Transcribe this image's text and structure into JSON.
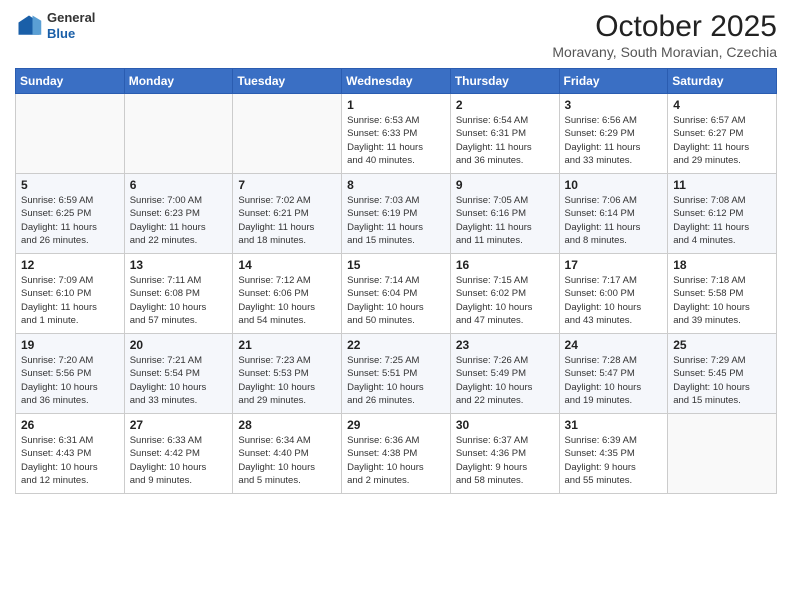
{
  "header": {
    "logo": {
      "general": "General",
      "blue": "Blue"
    },
    "month_year": "October 2025",
    "location": "Moravany, South Moravian, Czechia"
  },
  "days_of_week": [
    "Sunday",
    "Monday",
    "Tuesday",
    "Wednesday",
    "Thursday",
    "Friday",
    "Saturday"
  ],
  "weeks": [
    [
      {
        "day": "",
        "detail": ""
      },
      {
        "day": "",
        "detail": ""
      },
      {
        "day": "",
        "detail": ""
      },
      {
        "day": "1",
        "detail": "Sunrise: 6:53 AM\nSunset: 6:33 PM\nDaylight: 11 hours\nand 40 minutes."
      },
      {
        "day": "2",
        "detail": "Sunrise: 6:54 AM\nSunset: 6:31 PM\nDaylight: 11 hours\nand 36 minutes."
      },
      {
        "day": "3",
        "detail": "Sunrise: 6:56 AM\nSunset: 6:29 PM\nDaylight: 11 hours\nand 33 minutes."
      },
      {
        "day": "4",
        "detail": "Sunrise: 6:57 AM\nSunset: 6:27 PM\nDaylight: 11 hours\nand 29 minutes."
      }
    ],
    [
      {
        "day": "5",
        "detail": "Sunrise: 6:59 AM\nSunset: 6:25 PM\nDaylight: 11 hours\nand 26 minutes."
      },
      {
        "day": "6",
        "detail": "Sunrise: 7:00 AM\nSunset: 6:23 PM\nDaylight: 11 hours\nand 22 minutes."
      },
      {
        "day": "7",
        "detail": "Sunrise: 7:02 AM\nSunset: 6:21 PM\nDaylight: 11 hours\nand 18 minutes."
      },
      {
        "day": "8",
        "detail": "Sunrise: 7:03 AM\nSunset: 6:19 PM\nDaylight: 11 hours\nand 15 minutes."
      },
      {
        "day": "9",
        "detail": "Sunrise: 7:05 AM\nSunset: 6:16 PM\nDaylight: 11 hours\nand 11 minutes."
      },
      {
        "day": "10",
        "detail": "Sunrise: 7:06 AM\nSunset: 6:14 PM\nDaylight: 11 hours\nand 8 minutes."
      },
      {
        "day": "11",
        "detail": "Sunrise: 7:08 AM\nSunset: 6:12 PM\nDaylight: 11 hours\nand 4 minutes."
      }
    ],
    [
      {
        "day": "12",
        "detail": "Sunrise: 7:09 AM\nSunset: 6:10 PM\nDaylight: 11 hours\nand 1 minute."
      },
      {
        "day": "13",
        "detail": "Sunrise: 7:11 AM\nSunset: 6:08 PM\nDaylight: 10 hours\nand 57 minutes."
      },
      {
        "day": "14",
        "detail": "Sunrise: 7:12 AM\nSunset: 6:06 PM\nDaylight: 10 hours\nand 54 minutes."
      },
      {
        "day": "15",
        "detail": "Sunrise: 7:14 AM\nSunset: 6:04 PM\nDaylight: 10 hours\nand 50 minutes."
      },
      {
        "day": "16",
        "detail": "Sunrise: 7:15 AM\nSunset: 6:02 PM\nDaylight: 10 hours\nand 47 minutes."
      },
      {
        "day": "17",
        "detail": "Sunrise: 7:17 AM\nSunset: 6:00 PM\nDaylight: 10 hours\nand 43 minutes."
      },
      {
        "day": "18",
        "detail": "Sunrise: 7:18 AM\nSunset: 5:58 PM\nDaylight: 10 hours\nand 39 minutes."
      }
    ],
    [
      {
        "day": "19",
        "detail": "Sunrise: 7:20 AM\nSunset: 5:56 PM\nDaylight: 10 hours\nand 36 minutes."
      },
      {
        "day": "20",
        "detail": "Sunrise: 7:21 AM\nSunset: 5:54 PM\nDaylight: 10 hours\nand 33 minutes."
      },
      {
        "day": "21",
        "detail": "Sunrise: 7:23 AM\nSunset: 5:53 PM\nDaylight: 10 hours\nand 29 minutes."
      },
      {
        "day": "22",
        "detail": "Sunrise: 7:25 AM\nSunset: 5:51 PM\nDaylight: 10 hours\nand 26 minutes."
      },
      {
        "day": "23",
        "detail": "Sunrise: 7:26 AM\nSunset: 5:49 PM\nDaylight: 10 hours\nand 22 minutes."
      },
      {
        "day": "24",
        "detail": "Sunrise: 7:28 AM\nSunset: 5:47 PM\nDaylight: 10 hours\nand 19 minutes."
      },
      {
        "day": "25",
        "detail": "Sunrise: 7:29 AM\nSunset: 5:45 PM\nDaylight: 10 hours\nand 15 minutes."
      }
    ],
    [
      {
        "day": "26",
        "detail": "Sunrise: 6:31 AM\nSunset: 4:43 PM\nDaylight: 10 hours\nand 12 minutes."
      },
      {
        "day": "27",
        "detail": "Sunrise: 6:33 AM\nSunset: 4:42 PM\nDaylight: 10 hours\nand 9 minutes."
      },
      {
        "day": "28",
        "detail": "Sunrise: 6:34 AM\nSunset: 4:40 PM\nDaylight: 10 hours\nand 5 minutes."
      },
      {
        "day": "29",
        "detail": "Sunrise: 6:36 AM\nSunset: 4:38 PM\nDaylight: 10 hours\nand 2 minutes."
      },
      {
        "day": "30",
        "detail": "Sunrise: 6:37 AM\nSunset: 4:36 PM\nDaylight: 9 hours\nand 58 minutes."
      },
      {
        "day": "31",
        "detail": "Sunrise: 6:39 AM\nSunset: 4:35 PM\nDaylight: 9 hours\nand 55 minutes."
      },
      {
        "day": "",
        "detail": ""
      }
    ]
  ]
}
